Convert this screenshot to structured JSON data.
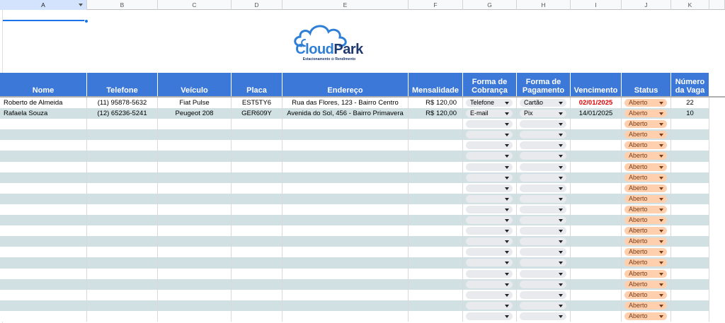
{
  "columns": [
    {
      "letter": "A",
      "w": 123
    },
    {
      "letter": "B",
      "w": 100
    },
    {
      "letter": "C",
      "w": 104
    },
    {
      "letter": "D",
      "w": 72
    },
    {
      "letter": "E",
      "w": 178
    },
    {
      "letter": "F",
      "w": 77
    },
    {
      "letter": "G",
      "w": 76
    },
    {
      "letter": "H",
      "w": 76
    },
    {
      "letter": "I",
      "w": 72
    },
    {
      "letter": "J",
      "w": 70
    },
    {
      "letter": "K",
      "w": 54
    }
  ],
  "logo": {
    "cloud": "Cloud",
    "park": "Park",
    "tagline": "Estacionamento ⊙ Rendimento"
  },
  "headers": {
    "nome": "Nome",
    "telefone": "Telefone",
    "veiculo": "Veículo",
    "placa": "Placa",
    "endereco": "Endereço",
    "mensalidade": "Mensalidade",
    "forma_cobranca_1": "Forma de",
    "forma_cobranca_2": "Cobrança",
    "forma_pagamento_1": "Forma de",
    "forma_pagamento_2": "Pagamento",
    "vencimento": "Vencimento",
    "status": "Status",
    "numero_vaga_1": "Número",
    "numero_vaga_2": "da Vaga"
  },
  "records": [
    {
      "nome": "Roberto de Almeida",
      "telefone": "(11) 95878-5632",
      "veiculo": "Fiat Pulse",
      "placa": "EST5TY6",
      "endereco": "Rua das Flores, 123 - Bairro Centro",
      "mensalidade": "R$ 120,00",
      "forma_cobranca": "Telefone",
      "forma_pagamento": "Cartão",
      "vencimento": "02/01/2025",
      "vencimento_overdue": true,
      "status": "Aberto",
      "vaga": "22"
    },
    {
      "nome": "Rafaela Souza",
      "telefone": "(12) 65236-5241",
      "veiculo": "Peugeot 208",
      "placa": "GER609Y",
      "endereco": "Avenida do Sol, 456 - Bairro Primavera",
      "mensalidade": "R$ 120,00",
      "forma_cobranca": "E-mail",
      "forma_pagamento": "Pix",
      "vencimento": "14/01/2025",
      "vencimento_overdue": false,
      "status": "Aberto",
      "vaga": "10"
    }
  ],
  "empty_rows_count": 19,
  "empty_status": "Aberto",
  "colors": {
    "header_bg": "#3c78d8",
    "band": "#d0e0e3",
    "status_chip": "#ffcfae",
    "overdue": "#e00000",
    "logo_blue": "#2f7fd6",
    "logo_navy": "#1f3a6e"
  }
}
